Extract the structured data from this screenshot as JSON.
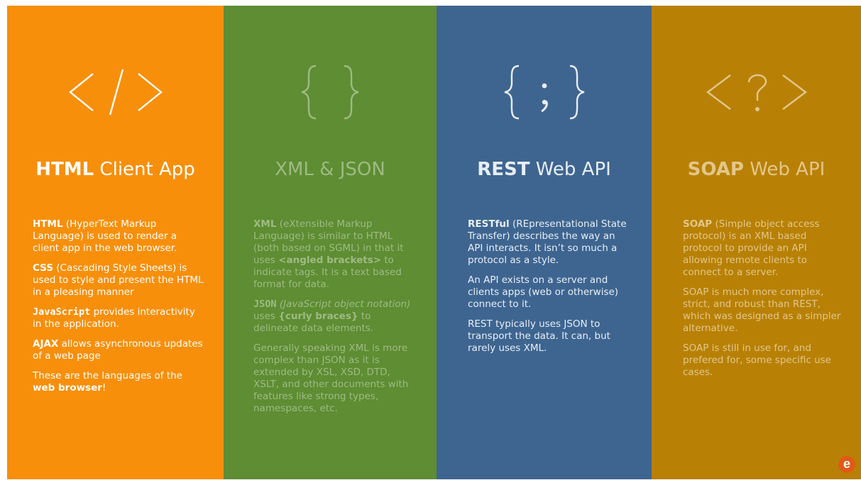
{
  "columns": {
    "html": {
      "icon_name": "html-tag-icon",
      "title_bold": "HTML",
      "title_rest": " Client App",
      "paras": [
        {
          "term": "HTML",
          "text": " (HyperText Markup Language) is used to render a client app in the web browser."
        },
        {
          "term": "CSS",
          "text": " (Cascading Style Sheets) is used to style and present the HTML in a pleasing manner"
        },
        {
          "term": "JavaScript",
          "text": " provides interactivity in the application."
        },
        {
          "term": "AJAX",
          "text": " allows asynchronous updates of a web page"
        }
      ],
      "closing_pre": "These are the languages of the ",
      "closing_bold": "web browser",
      "closing_post": "!"
    },
    "xml": {
      "icon_name": "curly-braces-icon",
      "title": "XML & JSON",
      "p1_term": "XML",
      "p1_text": " (eXtensible Markup Language) is similar to HTML (both based on SGML) in that it uses ",
      "p1_bold": "<angled brackets>",
      "p1_text2": " to indicate tags. It is a text based format for data.",
      "p2_term": "JSON",
      "p2_ital": " (JavaScript object notation)",
      "p2_text": " uses ",
      "p2_bold": "{curly braces}",
      "p2_text2": " to delineate data elements.",
      "p3": "Generally speaking XML is more complex than JSON as it is extended by XSL, XSD, DTD, XSLT, and other documents with features like strong types, namespaces, etc."
    },
    "rest": {
      "icon_name": "braces-semicolon-icon",
      "title_bold": "REST",
      "title_rest": " Web API",
      "p1_term": "RESTful",
      "p1_text": " (REpresentational State Transfer) describes the way an API interacts. It isn’t so much a protocol as a style.",
      "p2": "An API exists on a server and clients apps (web or otherwise) connect to it.",
      "p3": "REST typically uses JSON to transport the data. It can, but rarely uses XML."
    },
    "soap": {
      "icon_name": "xml-declaration-icon",
      "title_bold": "SOAP",
      "title_rest": " Web API",
      "p1_term": "SOAP",
      "p1_text": " (Simple object access protocol) is an XML based protocol to provide an API allowing remote clients to connect to a server.",
      "p2": "SOAP is much more complex, strict, and robust than REST, which was designed as a simpler alternative.",
      "p3": "SOAP is still in use for, and prefered for, some specific use cases."
    }
  },
  "logo": {
    "letter": "e",
    "color": "#e05a16"
  },
  "colors": {
    "html_bg": "#f78f0b",
    "xml_bg": "#5e8d33",
    "rest_bg": "#3e6590",
    "soap_bg": "#b88106"
  }
}
